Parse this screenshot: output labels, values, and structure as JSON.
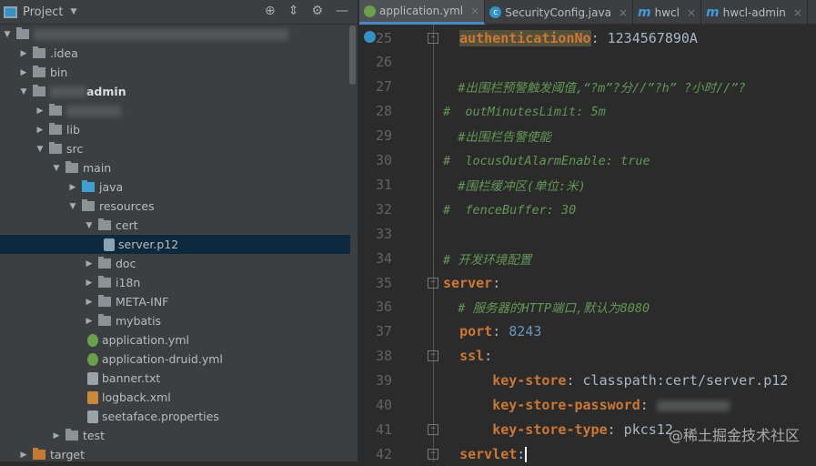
{
  "project_panel": {
    "title": "Project",
    "root_blurred": true,
    "items": [
      {
        "label": ".idea",
        "level": 1,
        "kind": "folder",
        "expanded": false
      },
      {
        "label": "bin",
        "level": 1,
        "kind": "folder",
        "expanded": false
      },
      {
        "label": "admin",
        "level": 1,
        "kind": "module",
        "expanded": true
      },
      {
        "label": "",
        "level": 2,
        "kind": "folder",
        "expanded": false
      },
      {
        "label": "lib",
        "level": 2,
        "kind": "folder",
        "expanded": false
      },
      {
        "label": "src",
        "level": 2,
        "kind": "folder",
        "expanded": true
      },
      {
        "label": "main",
        "level": 3,
        "kind": "folder",
        "expanded": true
      },
      {
        "label": "java",
        "level": 4,
        "kind": "source",
        "expanded": false
      },
      {
        "label": "resources",
        "level": 4,
        "kind": "resources",
        "expanded": true
      },
      {
        "label": "cert",
        "level": 5,
        "kind": "folder",
        "expanded": true
      },
      {
        "label": "server.p12",
        "level": 6,
        "kind": "file",
        "selected": true
      },
      {
        "label": "doc",
        "level": 5,
        "kind": "folder",
        "expanded": false
      },
      {
        "label": "i18n",
        "level": 5,
        "kind": "folder",
        "expanded": false
      },
      {
        "label": "META-INF",
        "level": 5,
        "kind": "folder",
        "expanded": false
      },
      {
        "label": "mybatis",
        "level": 5,
        "kind": "folder",
        "expanded": false
      },
      {
        "label": "application.yml",
        "level": 5,
        "kind": "yml"
      },
      {
        "label": "application-druid.yml",
        "level": 5,
        "kind": "yml"
      },
      {
        "label": "banner.txt",
        "level": 5,
        "kind": "txt"
      },
      {
        "label": "logback.xml",
        "level": 5,
        "kind": "xml"
      },
      {
        "label": "seetaface.properties",
        "level": 5,
        "kind": "txt"
      },
      {
        "label": "test",
        "level": 3,
        "kind": "folder",
        "expanded": false
      },
      {
        "label": "target",
        "level": 1,
        "kind": "target",
        "expanded": false
      }
    ]
  },
  "tabs": [
    {
      "label": "application.yml",
      "icon": "spring-icon",
      "active": true
    },
    {
      "label": "SecurityConfig.java",
      "icon": "class-icon"
    },
    {
      "label": "hwcl",
      "icon": "maven-icon"
    },
    {
      "label": "hwcl-admin",
      "icon": "maven-icon"
    }
  ],
  "editor": {
    "lines": [
      {
        "n": "25",
        "fold": true,
        "segs": [
          [
            "  ",
            ""
          ],
          [
            "authenticationNo",
            "k hl"
          ],
          [
            ": 1234567890A",
            ""
          ]
        ]
      },
      {
        "n": "26",
        "segs": []
      },
      {
        "n": "27",
        "segs": [
          [
            "  #出围栏预警触发阈值,“?m”?分//”?h” ?小时//”?",
            "c"
          ]
        ]
      },
      {
        "n": "28",
        "segs": [
          [
            "#  outMinutesLimit: 5m",
            "c"
          ]
        ]
      },
      {
        "n": "29",
        "segs": [
          [
            "  #出围栏告警使能",
            "c"
          ]
        ]
      },
      {
        "n": "30",
        "segs": [
          [
            "#  locusOutAlarmEnable: true",
            "c"
          ]
        ]
      },
      {
        "n": "31",
        "segs": [
          [
            "  #围栏缓冲区(单位:米)",
            "c"
          ]
        ]
      },
      {
        "n": "32",
        "segs": [
          [
            "#  fenceBuffer: 30",
            "c"
          ]
        ]
      },
      {
        "n": "33",
        "segs": []
      },
      {
        "n": "34",
        "segs": [
          [
            "# 开发环境配置",
            "c"
          ]
        ]
      },
      {
        "n": "35",
        "fold": true,
        "segs": [
          [
            "server",
            "k"
          ],
          [
            ":",
            ""
          ]
        ]
      },
      {
        "n": "36",
        "segs": [
          [
            "  # 服务器的HTTP端口,默认为8080",
            "c"
          ]
        ]
      },
      {
        "n": "37",
        "segs": [
          [
            "  ",
            ""
          ],
          [
            "port",
            "k"
          ],
          [
            ": ",
            ""
          ],
          [
            "8243",
            "n"
          ]
        ]
      },
      {
        "n": "38",
        "fold": true,
        "segs": [
          [
            "  ",
            ""
          ],
          [
            "ssl",
            "k"
          ],
          [
            ":",
            ""
          ]
        ]
      },
      {
        "n": "39",
        "segs": [
          [
            "      ",
            ""
          ],
          [
            "key-store",
            "k"
          ],
          [
            ": classpath:cert/server.p12",
            ""
          ]
        ]
      },
      {
        "n": "40",
        "segs": [
          [
            "      ",
            ""
          ],
          [
            "key-store-password",
            "k"
          ],
          [
            ": ",
            ""
          ]
        ],
        "blurred_value": true
      },
      {
        "n": "41",
        "fold": true,
        "segs": [
          [
            "      ",
            ""
          ],
          [
            "key-store-type",
            "k"
          ],
          [
            ": pkcs12",
            ""
          ]
        ]
      },
      {
        "n": "42",
        "fold": true,
        "segs": [
          [
            "  ",
            ""
          ],
          [
            "servlet",
            "k"
          ],
          [
            ":",
            ""
          ]
        ],
        "caret": true
      }
    ]
  },
  "watermark": "@稀土掘金技术社区"
}
